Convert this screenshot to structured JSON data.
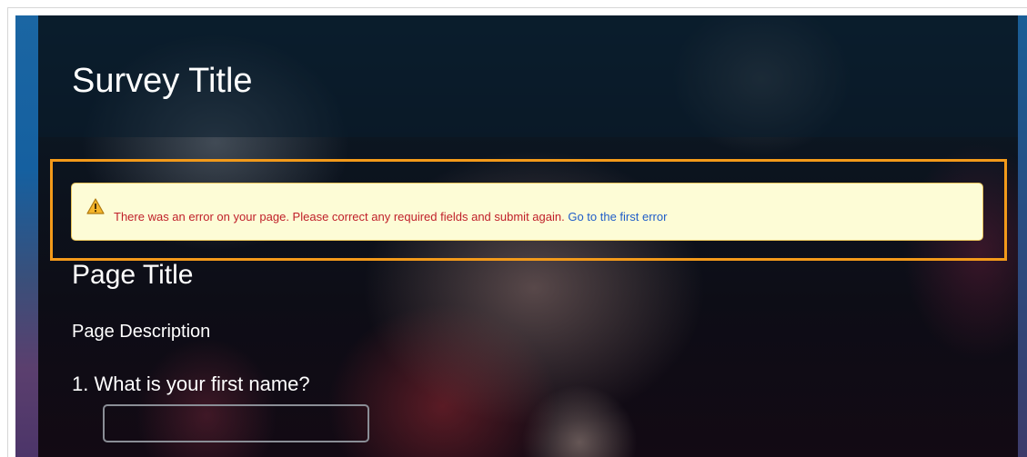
{
  "survey": {
    "title": "Survey Title"
  },
  "error_banner": {
    "icon": "warning-icon",
    "message": "There was an error on your page. Please correct any required fields and submit again.",
    "link_label": "Go to the first error",
    "highlight_color": "#f39a1a",
    "message_color": "#c0202a",
    "link_color": "#1f5dc8"
  },
  "page": {
    "title": "Page Title",
    "description": "Page Description"
  },
  "questions": [
    {
      "label": "1. What is your first name?",
      "value": "",
      "placeholder": ""
    }
  ]
}
